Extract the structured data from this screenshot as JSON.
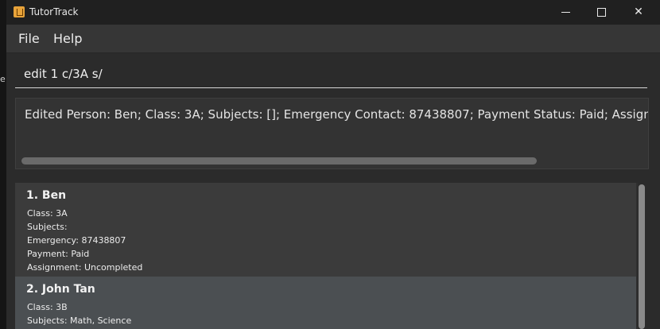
{
  "app": {
    "title": "TutorTrack",
    "edge_char": "e"
  },
  "window_controls": {
    "minimize": "minimize",
    "maximize": "maximize",
    "close": "✕"
  },
  "menu": {
    "file": "File",
    "help": "Help"
  },
  "command": {
    "value": "edit 1 c/3A s/"
  },
  "result": {
    "text": "Edited Person: Ben; Class: 3A; Subjects: []; Emergency Contact: 87438807; Payment Status: Paid; Assignment Status: Uncompleted"
  },
  "persons": [
    {
      "name": "1. Ben",
      "class": "Class: 3A",
      "subjects": "Subjects:",
      "emergency": "Emergency: 87438807",
      "payment": "Payment: Paid",
      "assignment": "Assignment: Uncompleted"
    },
    {
      "name": "2. John Tan",
      "class": "Class: 3B",
      "subjects": "Subjects: Math, Science"
    }
  ]
}
